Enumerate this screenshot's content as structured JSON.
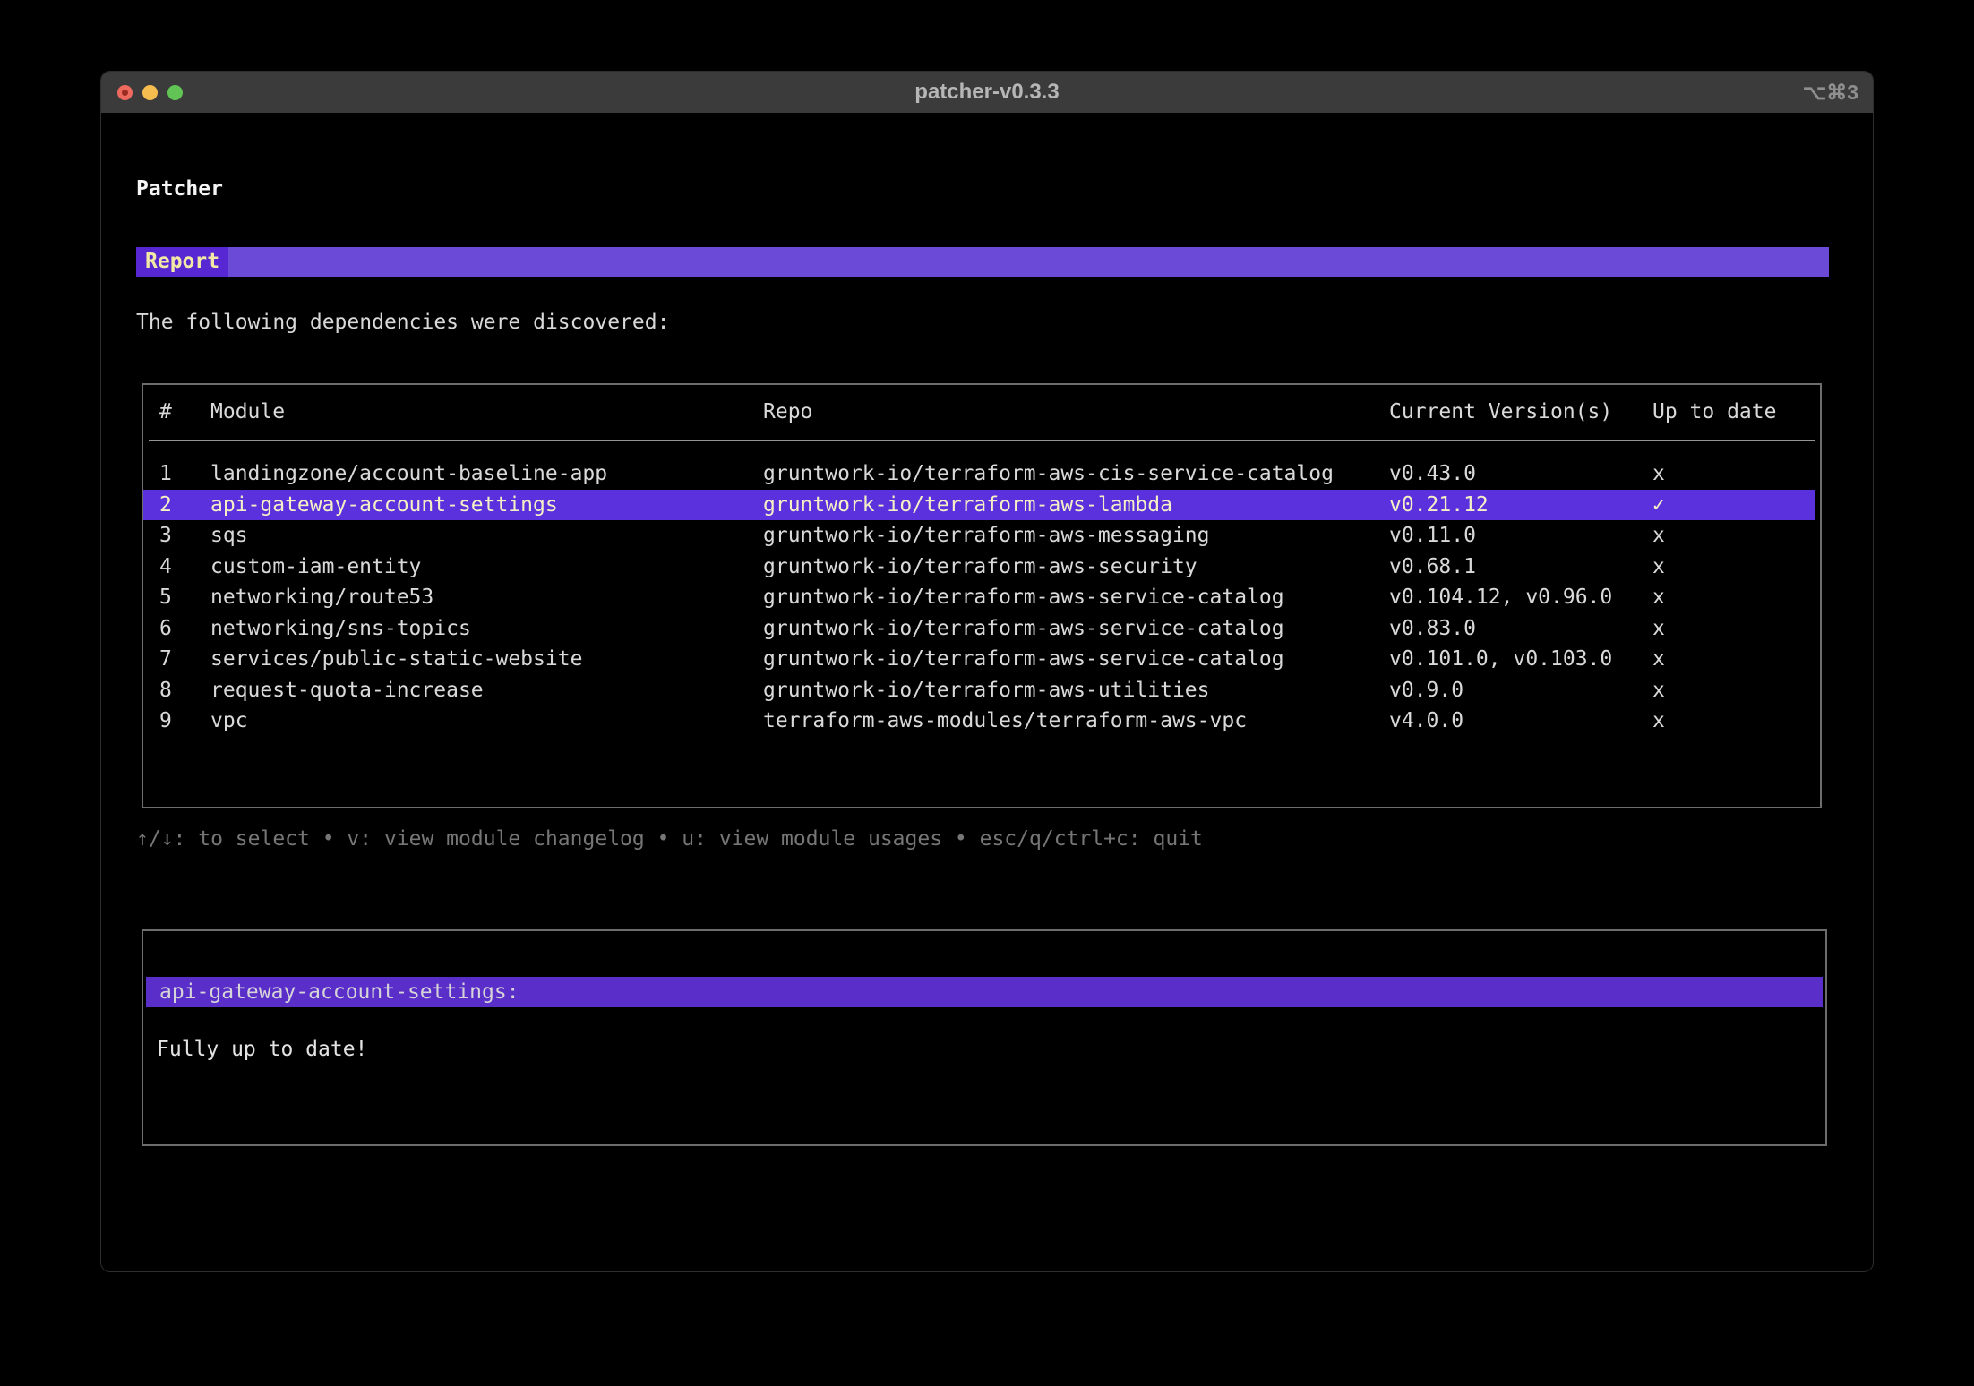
{
  "window": {
    "title": "patcher-v0.3.3",
    "shortcut": "⌥⌘3"
  },
  "app": {
    "heading": "Patcher",
    "tab": "Report",
    "intro": "The following dependencies were discovered:"
  },
  "table": {
    "headers": {
      "num": "#",
      "module": "Module",
      "repo": "Repo",
      "version": "Current Version(s)",
      "uptodate": "Up to date"
    },
    "rows": [
      {
        "num": "1",
        "module": "landingzone/account-baseline-app",
        "repo": "gruntwork-io/terraform-aws-cis-service-catalog",
        "version": "v0.43.0",
        "uptodate": "x",
        "selected": false
      },
      {
        "num": "2",
        "module": "api-gateway-account-settings",
        "repo": "gruntwork-io/terraform-aws-lambda",
        "version": "v0.21.12",
        "uptodate": "✓",
        "selected": true
      },
      {
        "num": "3",
        "module": "sqs",
        "repo": "gruntwork-io/terraform-aws-messaging",
        "version": "v0.11.0",
        "uptodate": "x",
        "selected": false
      },
      {
        "num": "4",
        "module": "custom-iam-entity",
        "repo": "gruntwork-io/terraform-aws-security",
        "version": "v0.68.1",
        "uptodate": "x",
        "selected": false
      },
      {
        "num": "5",
        "module": "networking/route53",
        "repo": "gruntwork-io/terraform-aws-service-catalog",
        "version": "v0.104.12, v0.96.0",
        "uptodate": "x",
        "selected": false
      },
      {
        "num": "6",
        "module": "networking/sns-topics",
        "repo": "gruntwork-io/terraform-aws-service-catalog",
        "version": "v0.83.0",
        "uptodate": "x",
        "selected": false
      },
      {
        "num": "7",
        "module": "services/public-static-website",
        "repo": "gruntwork-io/terraform-aws-service-catalog",
        "version": "v0.101.0, v0.103.0",
        "uptodate": "x",
        "selected": false
      },
      {
        "num": "8",
        "module": "request-quota-increase",
        "repo": "gruntwork-io/terraform-aws-utilities",
        "version": "v0.9.0",
        "uptodate": "x",
        "selected": false
      },
      {
        "num": "9",
        "module": "vpc",
        "repo": "terraform-aws-modules/terraform-aws-vpc",
        "version": "v4.0.0",
        "uptodate": "x",
        "selected": false
      }
    ]
  },
  "help": "↑/↓: to select • v: view module changelog • u: view module usages • esc/q/ctrl+c: quit",
  "detail": {
    "title": "api-gateway-account-settings:",
    "body": "Fully up to date!"
  },
  "colors": {
    "terminal-bg": "#000000",
    "titlebar-bg": "#3b3b3b",
    "title-text": "#b6b6b6",
    "shortcut-text": "#8f8f8f",
    "close-red": "#ee6a5f",
    "close-dot": "#9c2b20",
    "minimize-yellow": "#f5bd4f",
    "zoom-green": "#61c454",
    "text": "#d9d9d9",
    "heading-text": "#f5f5f5",
    "dim-text": "#767676",
    "banner-bg": "#6c4ad8",
    "tab-bg": "#5627d2",
    "tab-text": "#f2e9a6",
    "selection-bg": "#5b31dd",
    "selection-text": "#f4f0c6",
    "detail-bar-bg": "#5a2ec9",
    "detail-bar-text": "#d6d4d8",
    "detail-text": "#e3e3e3",
    "border": "#6d6d6d",
    "separator": "#949494"
  }
}
